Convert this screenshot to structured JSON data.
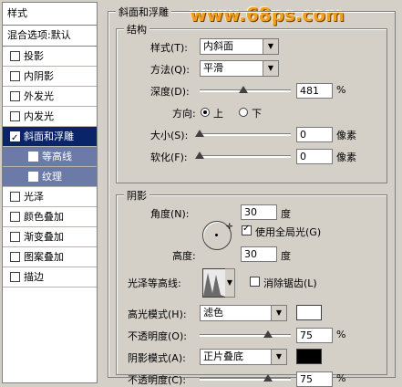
{
  "sidebar": {
    "header": "样式",
    "blend_options": "混合选项:默认",
    "items": [
      {
        "label": "投影",
        "checked": false
      },
      {
        "label": "内阴影",
        "checked": false
      },
      {
        "label": "外发光",
        "checked": false
      },
      {
        "label": "内发光",
        "checked": false
      },
      {
        "label": "斜面和浮雕",
        "checked": true,
        "selected": true
      },
      {
        "label": "等高线",
        "checked": false,
        "sub": true
      },
      {
        "label": "纹理",
        "checked": false,
        "sub": true
      },
      {
        "label": "光泽",
        "checked": false
      },
      {
        "label": "颜色叠加",
        "checked": false
      },
      {
        "label": "渐变叠加",
        "checked": false
      },
      {
        "label": "图案叠加",
        "checked": false
      },
      {
        "label": "描边",
        "checked": false
      }
    ]
  },
  "watermark": "www.68ps.com",
  "bevel": {
    "title": "斜面和浮雕",
    "structure": {
      "title": "结构",
      "style_label": "样式(T):",
      "style_value": "内斜面",
      "technique_label": "方法(Q):",
      "technique_value": "平滑",
      "depth_label": "深度(D):",
      "depth_value": "481",
      "depth_unit": "%",
      "depth_fraction": 0.48,
      "direction_label": "方向:",
      "direction_up": "上",
      "direction_down": "下",
      "size_label": "大小(S):",
      "size_value": "0",
      "size_unit": "像素",
      "soften_label": "软化(F):",
      "soften_value": "0",
      "soften_unit": "像素"
    },
    "shading": {
      "title": "阴影",
      "angle_label": "角度(N):",
      "angle_value": "30",
      "angle_unit": "度",
      "global_light_label": "使用全局光(G)",
      "global_light_checked": true,
      "altitude_label": "高度:",
      "altitude_value": "30",
      "altitude_unit": "度",
      "gloss_contour_label": "光泽等高线:",
      "anti_alias_label": "消除锯齿(L)",
      "anti_alias_checked": false,
      "highlight_mode_label": "高光模式(H):",
      "highlight_mode_value": "滤色",
      "highlight_color": "#ffffff",
      "highlight_opacity_label": "不透明度(O):",
      "highlight_opacity_value": "75",
      "highlight_opacity_unit": "%",
      "highlight_opacity_fraction": 0.75,
      "shadow_mode_label": "阴影模式(A):",
      "shadow_mode_value": "正片叠底",
      "shadow_color": "#000000",
      "shadow_opacity_label": "不透明度(C):",
      "shadow_opacity_value": "75",
      "shadow_opacity_unit": "%",
      "shadow_opacity_fraction": 0.75
    }
  }
}
